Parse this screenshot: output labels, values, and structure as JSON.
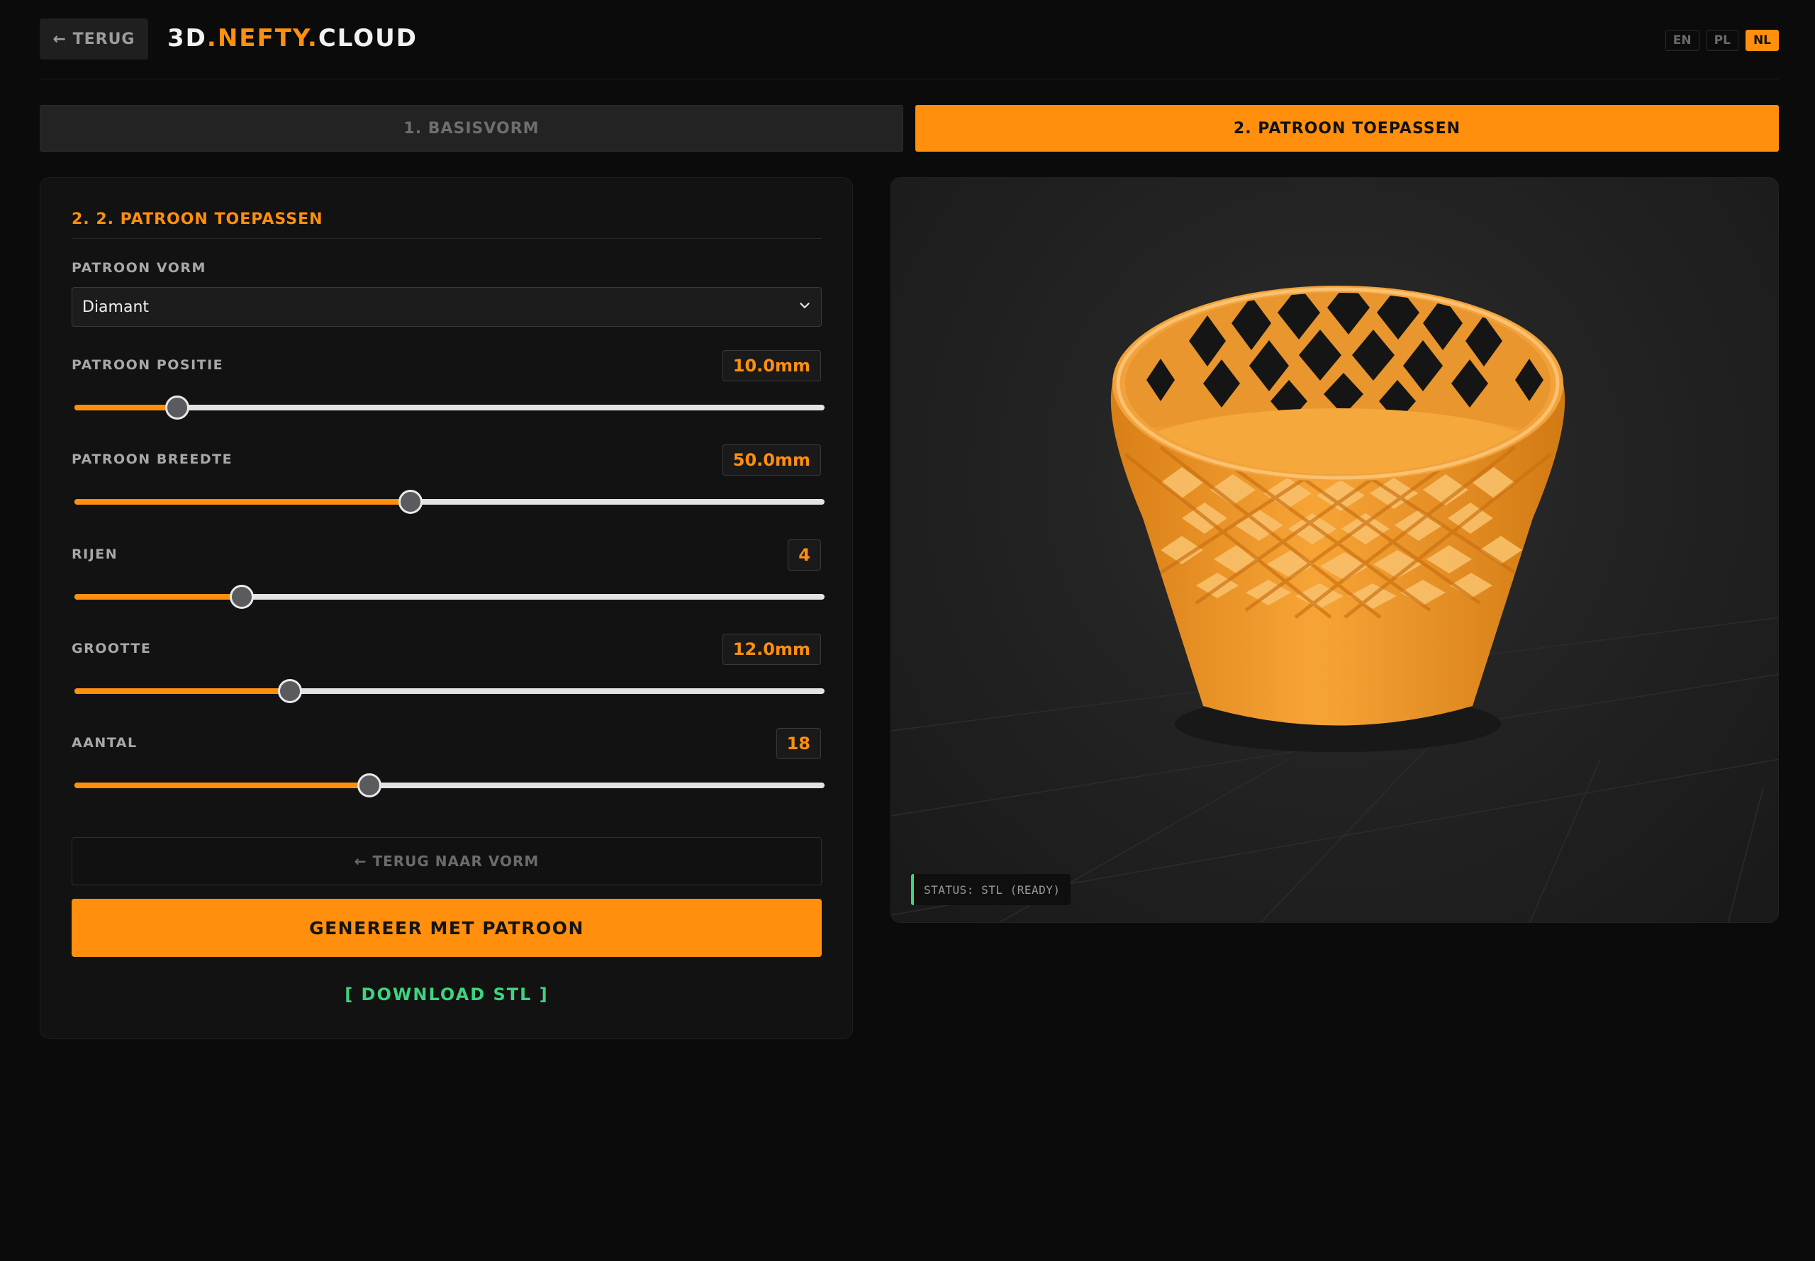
{
  "header": {
    "back_label": "← TERUG",
    "logo": {
      "part1": "3D",
      "dot1": ".",
      "part2": "NEFTY",
      "dot2": ".",
      "part3": "CLOUD"
    },
    "languages": [
      "EN",
      "PL",
      "NL"
    ],
    "active_language": "NL"
  },
  "tabs": [
    {
      "label": "1. BASISVORM",
      "active": false
    },
    {
      "label": "2. PATROON TOEPASSEN",
      "active": true
    }
  ],
  "panel": {
    "title": "2. 2. PATROON TOEPASSEN",
    "pattern_shape": {
      "label": "PATROON VORM",
      "value": "Diamant"
    },
    "sliders": [
      {
        "label": "PATROON POSITIE",
        "display": "10.0mm",
        "fraction": 0.137
      },
      {
        "label": "PATROON BREEDTE",
        "display": "50.0mm",
        "fraction": 0.448
      },
      {
        "label": "RIJEN",
        "display": "4",
        "fraction": 0.223
      },
      {
        "label": "GROOTTE",
        "display": "12.0mm",
        "fraction": 0.287
      },
      {
        "label": "AANTAL",
        "display": "18",
        "fraction": 0.393
      }
    ],
    "back_to_shape_label": "← TERUG NAAR VORM",
    "generate_label": "GENEREER MET PATROON",
    "download_label": "[ DOWNLOAD STL ]"
  },
  "viewer": {
    "status": "STATUS: STL (READY)"
  },
  "colors": {
    "accent": "#ff8f0d",
    "background": "#0b0b0b",
    "success": "#3ed47f",
    "model": "#f5a030"
  }
}
